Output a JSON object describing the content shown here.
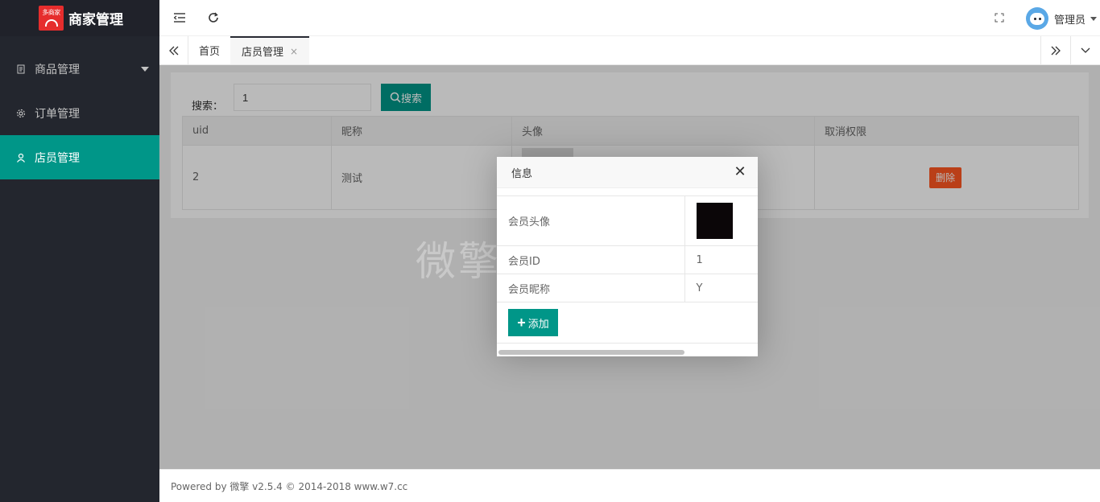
{
  "sidebar": {
    "logo_badge": "多商家",
    "app_title": "商家管理",
    "items": [
      {
        "label": "商品管理",
        "icon": "document-icon"
      },
      {
        "label": "订单管理",
        "icon": "gear-icon"
      },
      {
        "label": "店员管理",
        "icon": "user-icon"
      }
    ]
  },
  "header": {
    "user_name": "管理员"
  },
  "tabs": [
    {
      "label": "首页"
    },
    {
      "label": "店员管理",
      "close": "×"
    }
  ],
  "search": {
    "label": "搜索：",
    "value": "1",
    "button": "搜索"
  },
  "table": {
    "headers": [
      "uid",
      "昵称",
      "头像",
      "取消权限"
    ],
    "rows": [
      {
        "uid": "2",
        "nickname": "测试",
        "action": "删除"
      }
    ]
  },
  "watermark": "微擎应用商城",
  "modal": {
    "title": "信息",
    "close": "✕",
    "rows": [
      {
        "key": "会员头像",
        "value": ""
      },
      {
        "key": "会员ID",
        "value": "1"
      },
      {
        "key": "会员昵称",
        "value": "Y"
      }
    ],
    "add_button": "添加"
  },
  "footer": {
    "text": "Powered by 微擎 v2.5.4 © 2014-2018 www.w7.cc"
  },
  "colors": {
    "primary": "#009688",
    "danger": "#ff5722",
    "sidebar": "#23262e"
  }
}
